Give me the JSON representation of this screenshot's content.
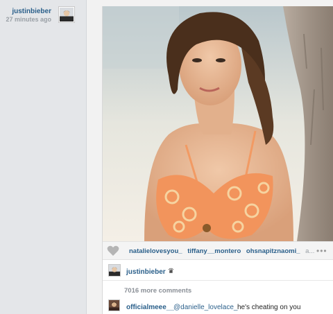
{
  "post": {
    "author": "justinbieber",
    "time_ago": "27 minutes ago"
  },
  "likes": {
    "users": [
      "natalielovesyou_",
      "tiffany__montero",
      "ohsnapitznaomi_"
    ],
    "overflow": "a...",
    "more_icon": "more-dots-icon"
  },
  "caption": {
    "user": "justinbieber",
    "text": "♛"
  },
  "comments": {
    "more_label": "7016 more comments",
    "items": [
      {
        "user": "officialmeee__",
        "mention": "@danielle_lovelace_",
        "text": "he's cheating on you"
      }
    ]
  },
  "colors": {
    "link": "#2a5f8a",
    "muted": "#9aa0a6",
    "background": "#ebebeb"
  }
}
